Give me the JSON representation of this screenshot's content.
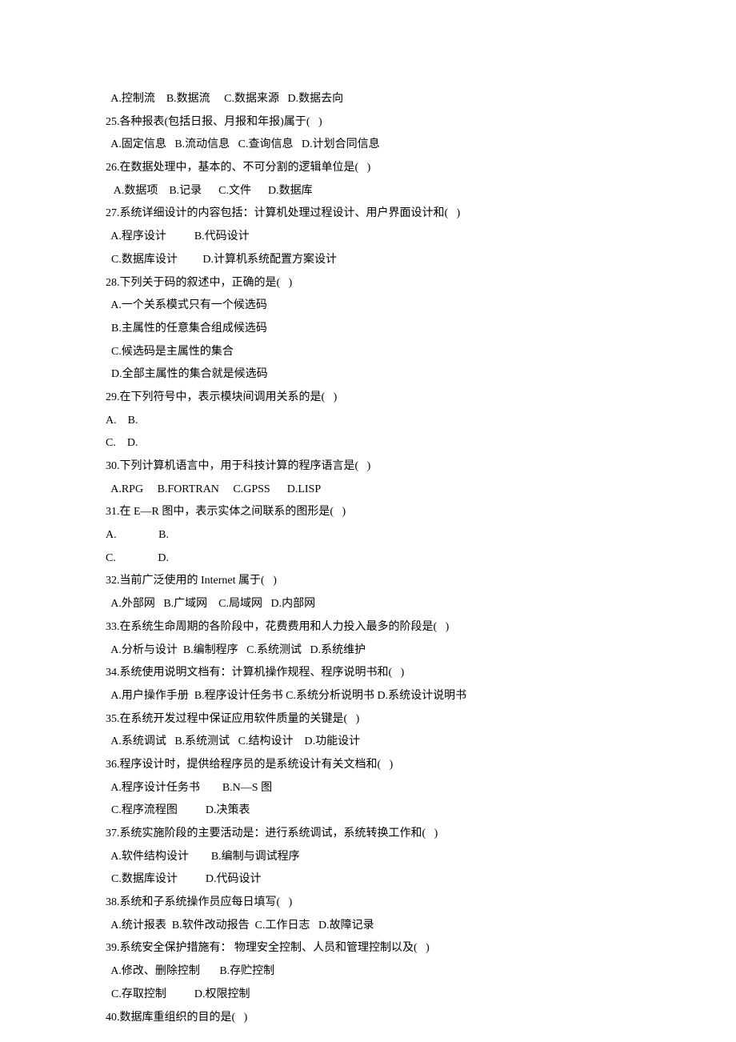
{
  "lines": {
    "l01": "  A.控制流    B.数据流     C.数据来源   D.数据去向",
    "l02": "25.各种报表(包括日报、月报和年报)属于(   )",
    "l03": "  A.固定信息   B.流动信息   C.查询信息   D.计划合同信息",
    "l04": "26.在数据处理中，基本的、不可分割的逻辑单位是(   )",
    "l05": "   A.数据项    B.记录      C.文件      D.数据库",
    "l06": "27.系统详细设计的内容包括：计算机处理过程设计、用户界面设计和(   )",
    "l07": "  A.程序设计          B.代码设计",
    "l08": "  C.数据库设计         D.计算机系统配置方案设计",
    "l09": "28.下列关于码的叙述中，正确的是(   )",
    "l10": "  A.一个关系模式只有一个候选码",
    "l11": "  B.主属性的任意集合组成候选码",
    "l12": "  C.候选码是主属性的集合",
    "l13": "  D.全部主属性的集合就是候选码",
    "l14": "29.在下列符号中，表示模块间调用关系的是(   )",
    "l15": "A.    B.",
    "l16": "",
    "l17": "C.    D.",
    "l18": "",
    "l19": "30.下列计算机语言中，用于科技计算的程序语言是(   )",
    "l20": "  A.RPG     B.FORTRAN     C.GPSS      D.LISP",
    "l21": "31.在 E—R 图中，表示实体之间联系的图形是(   )",
    "l22": "A.               B.",
    "l23": "",
    "l24": "C.               D.",
    "l25": "32.当前广泛使用的 Internet 属于(   )",
    "l26": "  A.外部网   B.广域网    C.局域网   D.内部网",
    "l27": "33.在系统生命周期的各阶段中，花费费用和人力投入最多的阶段是(   )",
    "l28": "  A.分析与设计  B.编制程序   C.系统测试   D.系统维护",
    "l29": "34.系统使用说明文档有：计算机操作规程、程序说明书和(   )",
    "l30": "  A.用户操作手册  B.程序设计任务书 C.系统分析说明书 D.系统设计说明书",
    "l31": "35.在系统开发过程中保证应用软件质量的关键是(   )",
    "l32": "  A.系统调试   B.系统测试   C.结构设计    D.功能设计",
    "l33": "36.程序设计时，提供给程序员的是系统设计有关文档和(   )",
    "l34": "  A.程序设计任务书        B.N—S 图",
    "l35": "  C.程序流程图          D.决策表",
    "l36": "37.系统实施阶段的主要活动是：进行系统调试，系统转换工作和(   )",
    "l37": "  A.软件结构设计        B.编制与调试程序",
    "l38": "  C.数据库设计          D.代码设计",
    "l39": "38.系统和子系统操作员应每日填写(   )",
    "l40": "  A.统计报表  B.软件改动报告  C.工作日志   D.故障记录",
    "l41": "39.系统安全保护措施有： 物理安全控制、人员和管理控制以及(   )",
    "l42": "  A.修改、删除控制       B.存贮控制",
    "l43": "  C.存取控制          D.权限控制",
    "l44": "40.数据库重组织的目的是(   )"
  }
}
